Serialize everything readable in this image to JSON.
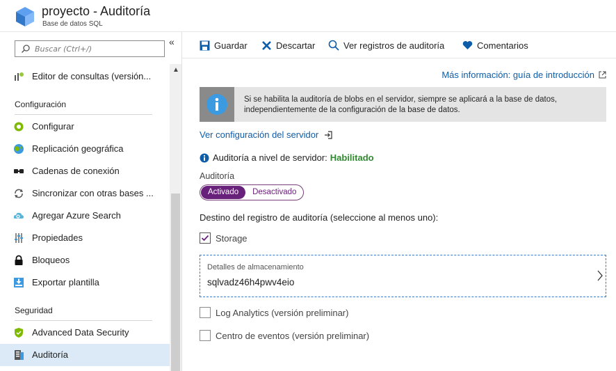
{
  "header": {
    "title": "proyecto - Auditoría",
    "subtitle": "Base de datos SQL",
    "logo_icon": "sql-database-cube-icon"
  },
  "sidebar": {
    "search_placeholder": "Buscar (Ctrl+/)",
    "collapse_label": "«",
    "items_top": [
      {
        "label": "Editor de consultas (versión...",
        "icon": "query-editor-icon"
      }
    ],
    "sections": [
      {
        "title": "Configuración",
        "items": [
          {
            "label": "Configurar",
            "icon": "configure-icon"
          },
          {
            "label": "Replicación geográfica",
            "icon": "globe-icon"
          },
          {
            "label": "Cadenas de conexión",
            "icon": "connection-strings-icon"
          },
          {
            "label": "Sincronizar con otras bases ...",
            "icon": "sync-icon"
          },
          {
            "label": "Agregar Azure Search",
            "icon": "cloud-search-icon"
          },
          {
            "label": "Propiedades",
            "icon": "properties-icon"
          },
          {
            "label": "Bloqueos",
            "icon": "lock-icon"
          },
          {
            "label": "Exportar plantilla",
            "icon": "export-template-icon"
          }
        ]
      },
      {
        "title": "Seguridad",
        "items": [
          {
            "label": "Advanced Data Security",
            "icon": "shield-icon"
          },
          {
            "label": "Auditoría",
            "icon": "audit-icon",
            "active": true
          }
        ]
      }
    ]
  },
  "toolbar": {
    "save_label": "Guardar",
    "discard_label": "Descartar",
    "view_logs_label": "Ver registros de auditoría",
    "feedback_label": "Comentarios"
  },
  "main": {
    "more_info_link": "Más información: guía de introducción",
    "banner_text": "Si se habilita la auditoría de blobs en el servidor, siempre se aplicará a la base de datos, independientemente de la configuración de la base de datos.",
    "server_link": "Ver configuración del servidor",
    "server_status_label": "Auditoría a nivel de servidor:",
    "server_status_value": "Habilitado",
    "audit_label": "Auditoría",
    "toggle_on": "Activado",
    "toggle_off": "Desactivado",
    "toggle_selected": "Activado",
    "destination_label": "Destino del registro de auditoría (seleccione al menos uno):",
    "storage_checkbox": {
      "label": "Storage",
      "checked": true
    },
    "storage_details_label": "Detalles de almacenamiento",
    "storage_details_value": "sqlvadz46h4pwv4eio",
    "log_analytics_checkbox": {
      "label": "Log Analytics (versión preliminar)",
      "checked": false
    },
    "event_hub_checkbox": {
      "label": "Centro de eventos (versión preliminar)",
      "checked": false
    }
  },
  "colors": {
    "accent_blue": "#0f5da8",
    "toggle_purple": "#68217a",
    "status_green": "#2f8a2f",
    "active_nav": "#dceaf7"
  }
}
